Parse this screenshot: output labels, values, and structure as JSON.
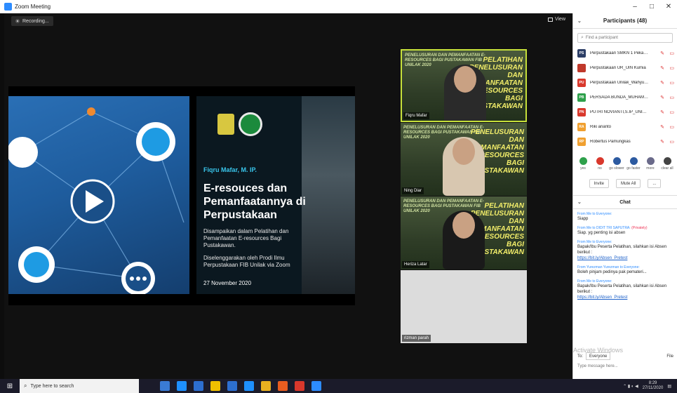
{
  "window": {
    "title": "Zoom Meeting",
    "controls": [
      "–",
      "□",
      "✕"
    ]
  },
  "meeting": {
    "recording_label": "Recording...",
    "view_label": "View"
  },
  "slide": {
    "presenter": "Fiqru Mafar, M. IP.",
    "title": "E-resouces dan Pemanfaatannya di Perpustakaan",
    "description": "Disampaikan dalam Pelatihan dan Pemanfaatan E-resources Bagi Pustakawan.",
    "organizer": "Diselenggarakan oleh Prodi Ilmu Perpustakaan FIB Unilak via Zoom",
    "date": "27 November 2020"
  },
  "tiles": [
    {
      "name": "Fiqru Mafar",
      "poster_text": "PENELUSURAN DAN PEMANFAATAN E-RESOURCES BAGI PUSTAKAWAN FIB UNILAK 2020",
      "poster_title": "PELATIHAN PENELUSURAN DAN PEMANFAATAN E-RESOURCES BAGI PUSTAKAWAN"
    },
    {
      "name": "Ning Diar",
      "poster_text": "PENELUSURAN DAN PEMANFAATAN E-RESOURCES BAGI PUSTAKAWAN FIB UNILAK 2020",
      "poster_title": "PENELUSURAN DAN PEMANFAATAN E-RESOURCES BAGI PUSTAKAWAN"
    },
    {
      "name": "Heriza Latar",
      "poster_text": "PENELUSURAN DAN PEMANFAATAN E-RESOURCES BAGI PUSTAKAWAN FIB UNILAK 2020",
      "poster_title": "PELATIHAN PENELUSURAN DAN PEMANFAATAN E-RESOURCES BAGI PUSTAKAWAN"
    },
    {
      "name": "rizman parah"
    }
  ],
  "participants": {
    "header": "Participants (48)",
    "search_placeholder": "Find a participant",
    "list": [
      {
        "initials": "PS",
        "name": "Perpustakaan SMKN 1 Pekanba...",
        "color": "#2c3e66"
      },
      {
        "initials": "",
        "name": "Perpustakaan UR_UIN Kumia",
        "color": "#c0392b"
      },
      {
        "initials": "PU",
        "name": "Perpustakaan Unilak_Wahyu Siw...",
        "color": "#d9382c"
      },
      {
        "initials": "PB",
        "name": "PERSADA BUNDA_MUHAMAR",
        "color": "#2ea04b"
      },
      {
        "initials": "PN",
        "name": "PUTRI NOVIANTI,S.IP_UNIVERSI...",
        "color": "#d9382c"
      },
      {
        "initials": "RA",
        "name": "Riki arianto",
        "color": "#f0a030"
      },
      {
        "initials": "RP",
        "name": "Robertus Pamungkas",
        "color": "#f0a030"
      }
    ],
    "reactions": [
      {
        "label": "yes",
        "color": "#2ea04b"
      },
      {
        "label": "no",
        "color": "#d9382c"
      },
      {
        "label": "go slower",
        "color": "#2c5aa0"
      },
      {
        "label": "go faster",
        "color": "#2c5aa0"
      },
      {
        "label": "more",
        "color": "#6a6a8a"
      },
      {
        "label": "clear all",
        "color": "#444"
      }
    ],
    "invite_label": "Invite",
    "mute_all_label": "Mute All",
    "more_label": "..."
  },
  "chat": {
    "header": "Chat",
    "messages": [
      {
        "from": "From Me to Everyone:",
        "private": "",
        "text": "Siapp",
        "link": ""
      },
      {
        "from": "From Me to DIDIT TRI SAPUTRA:",
        "private": "(Privately)",
        "text": "Siap. yg penting isi absen",
        "link": ""
      },
      {
        "from": "From Me to Everyone:",
        "private": "",
        "text": "Bapak/Ibu Peserta Pelatihan, silahkan isi Absen berikut :",
        "link": "https://bit.ly/Absen_Pretest"
      },
      {
        "from": "From Yurezman Yurezman to Everyone:",
        "private": "",
        "text": "Boleh pinjam pedinya pak pemateri...",
        "link": ""
      },
      {
        "from": "From Me to Everyone:",
        "private": "",
        "text": "Bapak/Ibu Peserta Pelatihan, silahkan isi Absen berikut :",
        "link": "https://bit.ly/Absen_Pretest"
      }
    ],
    "to_label": "To:",
    "to_value": "Everyone",
    "file_label": "File",
    "placeholder": "Type message here...",
    "watermark": "Activate Windows"
  },
  "taskbar": {
    "search_placeholder": "Type here to search",
    "time": "8:29",
    "date": "27/11/2020",
    "app_colors": [
      "#3a7bd5",
      "#1e90ff",
      "#2d6fd0",
      "#f0c000",
      "#2d6fd0",
      "#1e90ff",
      "#e8b020",
      "#e85d20",
      "#d9382c",
      "#2d8cff"
    ]
  }
}
